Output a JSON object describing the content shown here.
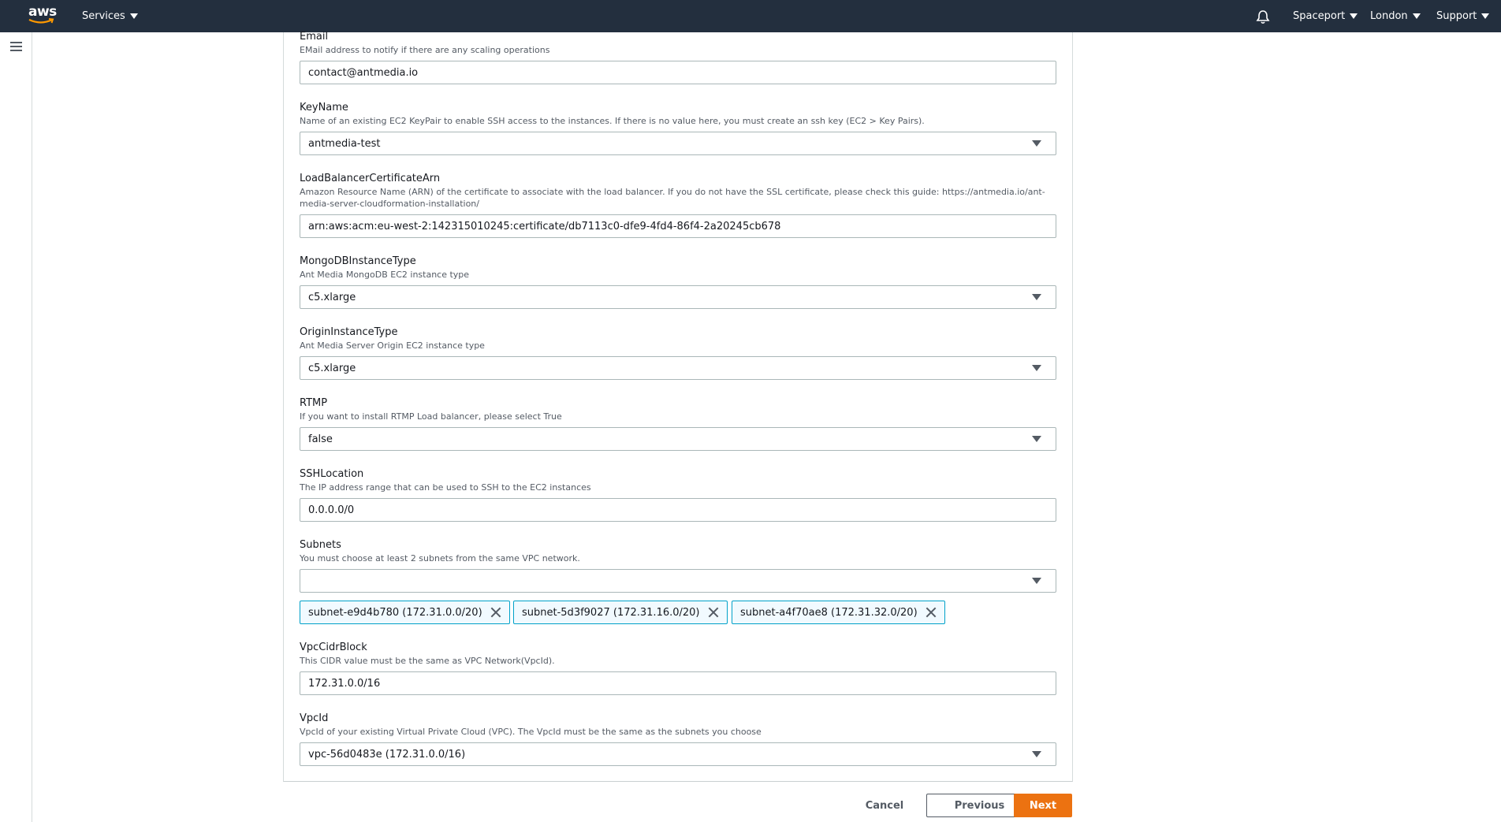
{
  "topnav": {
    "logo_text": "aws",
    "services_label": "Services",
    "account_label": "Spaceport",
    "region_label": "London",
    "support_label": "Support"
  },
  "fields": [
    {
      "label": "Email",
      "description": "EMail address to notify if there are any scaling operations",
      "value": "contact@antmedia.io",
      "type": "text"
    },
    {
      "label": "KeyName",
      "description": "Name of an existing EC2 KeyPair to enable SSH access to the instances. If there is no value here, you must create an ssh key (EC2 > Key Pairs).",
      "value": "antmedia-test",
      "type": "select"
    },
    {
      "label": "LoadBalancerCertificateArn",
      "description_line1": "Amazon Resource Name (ARN) of the certificate to associate with the load balancer. If you do not have the SSL certificate, please check this guide: https://antmedia.io/ant-",
      "description_line2": "media-server-cloudformation-installation/",
      "value": "arn:aws:acm:eu-west-2:142315010245:certificate/db7113c0-dfe9-4fd4-86f4-2a20245cb678",
      "type": "text"
    },
    {
      "label": "MongoDBInstanceType",
      "description": "Ant Media MongoDB EC2 instance type",
      "value": "c5.xlarge",
      "type": "select"
    },
    {
      "label": "OriginInstanceType",
      "description": "Ant Media Server Origin EC2 instance type",
      "value": "c5.xlarge",
      "type": "select"
    },
    {
      "label": "RTMP",
      "description": "If you want to install RTMP Load balancer, please select True",
      "value": "false",
      "type": "select"
    },
    {
      "label": "SSHLocation",
      "description": "The IP address range that can be used to SSH to the EC2 instances",
      "value": "0.0.0.0/0",
      "type": "text"
    },
    {
      "label": "Subnets",
      "description": "You must choose at least 2 subnets from the same VPC network.",
      "value": "",
      "type": "multiselect"
    },
    {
      "label": "VpcCidrBlock",
      "description": "This CIDR value must be the same as VPC Network(VpcId).",
      "value": "172.31.0.0/16",
      "type": "text"
    },
    {
      "label": "VpcId",
      "description": "VpcId of your existing Virtual Private Cloud (VPC). The VpcId must be the same as the subnets you choose",
      "value": "vpc-56d0483e (172.31.0.0/16)",
      "type": "select"
    }
  ],
  "subnet_tokens": [
    "subnet-e9d4b780 (172.31.0.0/20)",
    "subnet-5d3f9027 (172.31.16.0/20)",
    "subnet-a4f70ae8 (172.31.32.0/20)"
  ],
  "footer": {
    "cancel_label": "Cancel",
    "previous_label": "Previous",
    "next_label": "Next"
  },
  "colors": {
    "nav_bg": "#232f3e",
    "primary_button": "#ec7211",
    "token_border": "#00a1c9"
  }
}
